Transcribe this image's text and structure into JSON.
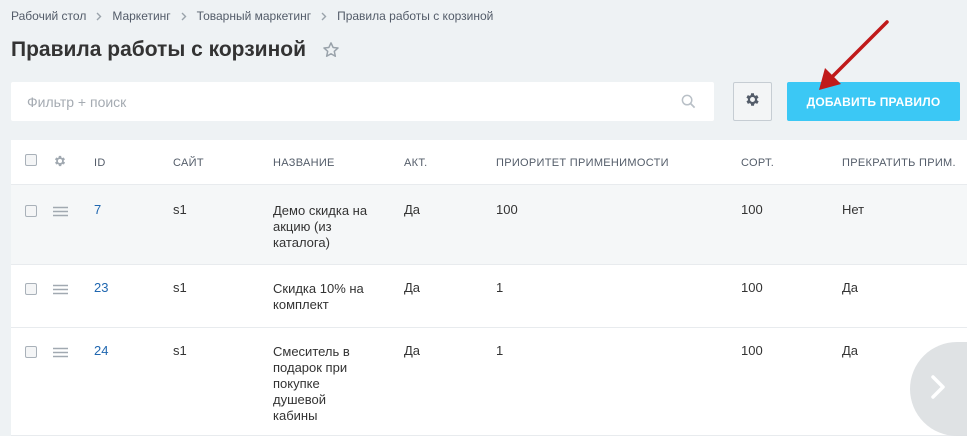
{
  "breadcrumb": [
    "Рабочий стол",
    "Маркетинг",
    "Товарный маркетинг",
    "Правила работы с корзиной"
  ],
  "page_title": "Правила работы с корзиной",
  "filter": {
    "placeholder": "Фильтр + поиск",
    "value": ""
  },
  "add_button_label": "ДОБАВИТЬ ПРАВИЛО",
  "accent_color": "#3bc8f5",
  "annotation": {
    "arrow_color": "#c01a1a"
  },
  "table": {
    "columns": [
      "ID",
      "САЙТ",
      "НАЗВАНИЕ",
      "АКТ.",
      "ПРИОРИТЕТ ПРИМЕНИМОСТИ",
      "СОРТ.",
      "ПРЕКРАТИТЬ ПРИМ."
    ],
    "rows": [
      {
        "id": "7",
        "site": "s1",
        "name": "Демо скидка на акцию (из каталога)",
        "active": "Да",
        "priority": "100",
        "sort": "100",
        "stop": "Нет"
      },
      {
        "id": "23",
        "site": "s1",
        "name": "Скидка 10% на комплект",
        "active": "Да",
        "priority": "1",
        "sort": "100",
        "stop": "Да"
      },
      {
        "id": "24",
        "site": "s1",
        "name": "Смеситель в подарок при покупке душевой кабины",
        "active": "Да",
        "priority": "1",
        "sort": "100",
        "stop": "Да"
      }
    ]
  }
}
